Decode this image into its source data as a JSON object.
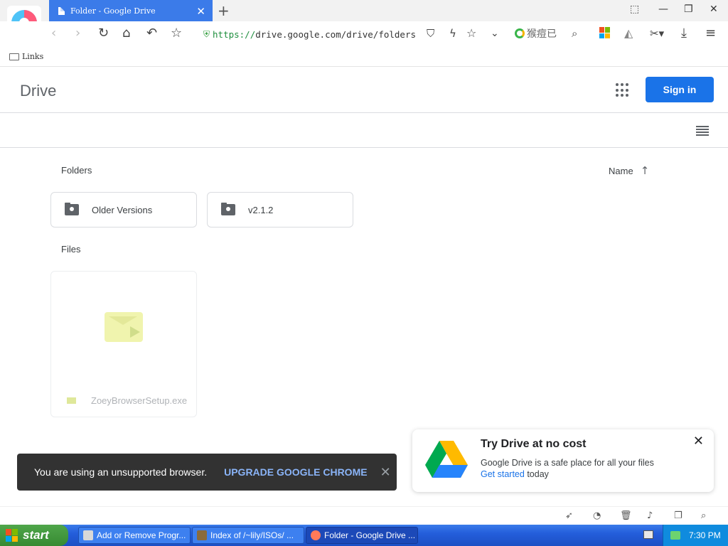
{
  "browser": {
    "tab_title": "Folder - Google Drive",
    "url_scheme": "https://",
    "url_rest": "drive.google.com/drive/folders",
    "search_text": "猴痘已",
    "bookmark_folder": "Links"
  },
  "drive": {
    "title": "Drive",
    "signin_label": "Sign in",
    "folders_label": "Folders",
    "files_label": "Files",
    "sort_label": "Name",
    "folders": [
      {
        "name": "Older Versions"
      },
      {
        "name": "v2.1.2"
      }
    ],
    "files": [
      {
        "name": "ZoeyBrowserSetup.exe"
      }
    ]
  },
  "snackbar": {
    "text": "You are using an unsupported browser.",
    "action": "UPGRADE GOOGLE CHROME"
  },
  "promo": {
    "title": "Try Drive at no cost",
    "description": "Google Drive is a safe place for all your files",
    "link": "Get started",
    "suffix": " today"
  },
  "taskbar": {
    "start_label": "start",
    "tasks": [
      {
        "label": "Add or Remove Progr..."
      },
      {
        "label": "Index of /~lily/ISOs/ ..."
      },
      {
        "label": "Folder - Google Drive ..."
      }
    ],
    "clock": "7:30 PM"
  },
  "colors": {
    "accent": "#1a73e8",
    "tab_active": "#3b7be9",
    "taskbar": "#245edb",
    "start": "#378a32",
    "snackbar": "#323232"
  }
}
